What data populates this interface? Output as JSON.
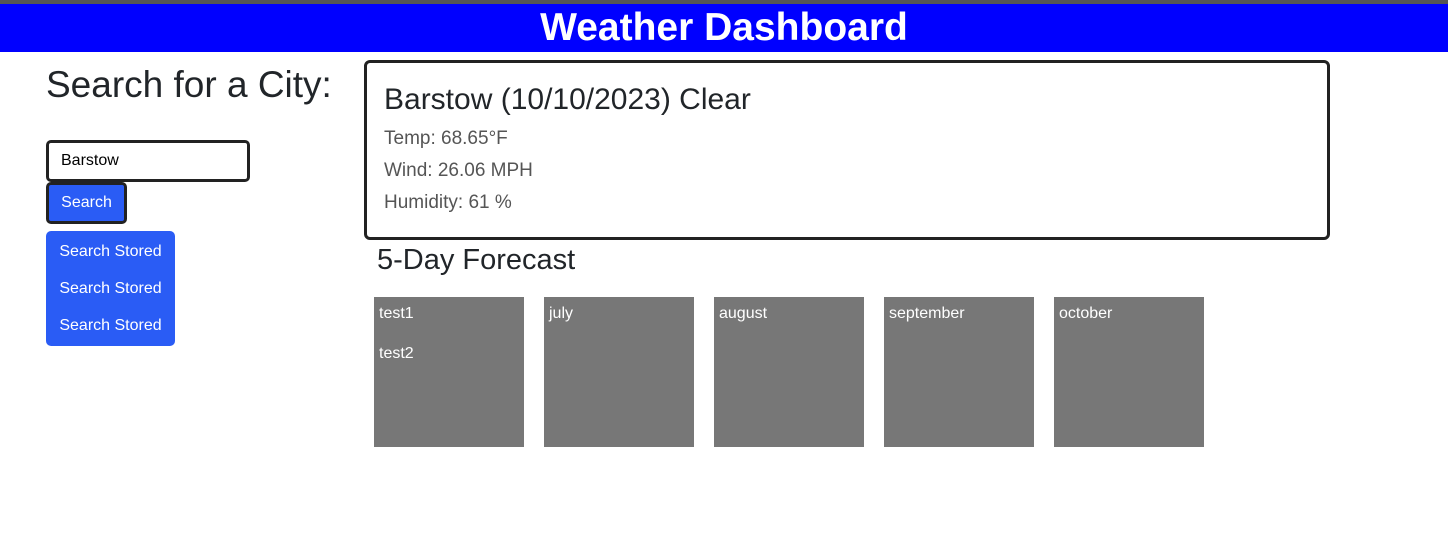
{
  "header": {
    "title": "Weather Dashboard"
  },
  "sidebar": {
    "title": "Search for a City:",
    "search_input_value": "Barstow",
    "search_button_label": "Search",
    "stored_buttons": [
      "Search Stored",
      "Search Stored",
      "Search Stored"
    ]
  },
  "current": {
    "title": "Barstow (10/10/2023) Clear",
    "temp": "Temp: 68.65°F",
    "wind": "Wind: 26.06 MPH",
    "humidity": "Humidity: 61 %"
  },
  "forecast": {
    "title": "5-Day Forecast",
    "cards": [
      {
        "lines": [
          "test1",
          "test2"
        ]
      },
      {
        "lines": [
          "july"
        ]
      },
      {
        "lines": [
          "august"
        ]
      },
      {
        "lines": [
          "september"
        ]
      },
      {
        "lines": [
          "october"
        ]
      }
    ]
  },
  "colors": {
    "header_bg": "#0000ff",
    "button_bg": "#2a5cf5",
    "forecast_card_bg": "#777777"
  }
}
